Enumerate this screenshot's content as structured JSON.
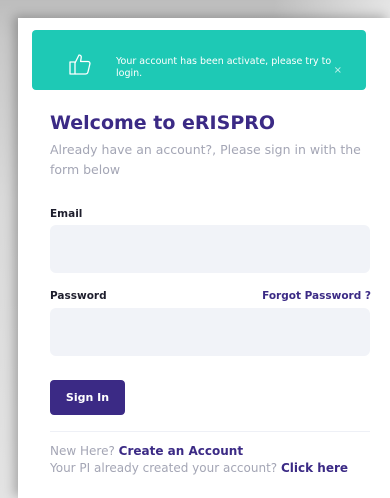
{
  "alert": {
    "message": "Your account has been activate, please try to login.",
    "icon": "thumbs-up-icon",
    "close_glyph": "×",
    "color": "#1ec9b5"
  },
  "heading": {
    "title": "Welcome to eRISPRO",
    "subtitle": "Already have an account?, Please sign in with the form below"
  },
  "form": {
    "email_label": "Email",
    "email_value": "",
    "password_label": "Password",
    "password_value": "",
    "forgot_link": "Forgot Password ?",
    "submit_label": "Sign In"
  },
  "footer": {
    "new_here_text": "New Here?",
    "create_account_link": "Create an Account",
    "pi_text": "Your PI already created your account?",
    "click_here_link": "Click here"
  },
  "colors": {
    "brand": "#3b2a85",
    "muted_text": "#a4a6b5",
    "input_bg": "#f1f3f8"
  }
}
